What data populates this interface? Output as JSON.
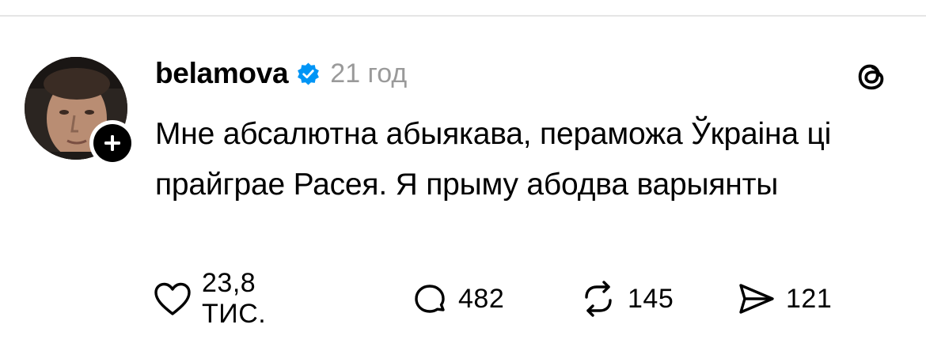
{
  "post": {
    "username": "belamova",
    "verified": true,
    "timestamp": "21 год",
    "text": "Мне абсалютна абыякава, пераможа Ўкраіна ці прайграе Расея. Я прыму абодва варыянты"
  },
  "actions": {
    "likes": "23,8 ТИС.",
    "replies": "482",
    "reposts": "145",
    "shares": "121"
  },
  "icons": {
    "like": "heart-icon",
    "reply": "speech-bubble-icon",
    "repost": "repost-icon",
    "share": "send-icon",
    "follow": "plus-icon",
    "verified": "verified-badge-icon",
    "app": "threads-logo-icon"
  },
  "colors": {
    "text": "#000000",
    "muted": "#9a9a9a",
    "verified": "#0095f6",
    "divider": "#e5e5e5"
  }
}
